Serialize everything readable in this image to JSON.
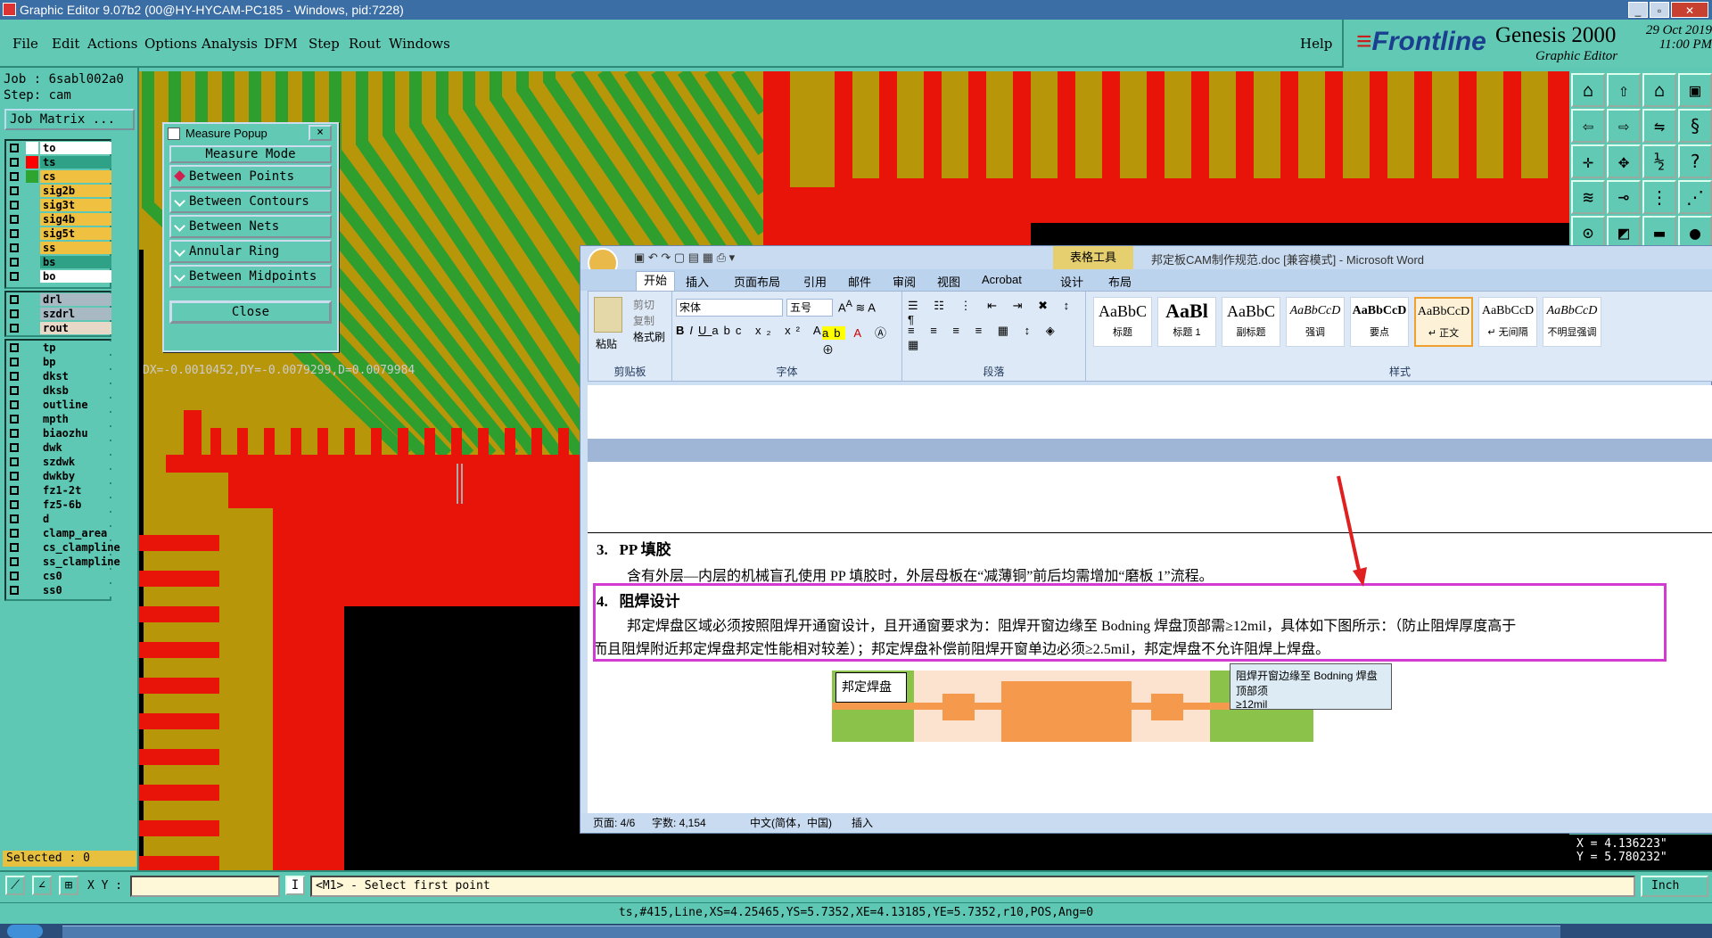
{
  "window": {
    "title": "Graphic Editor 9.07b2 (00@HY-HYCAM-PC185 - Windows, pid:7228)"
  },
  "menu": [
    "File",
    "Edit",
    "Actions",
    "Options",
    "Analysis",
    "DFM",
    "Step",
    "Rout",
    "Windows"
  ],
  "help_label": "Help",
  "brand": {
    "logo_main": "Frontline",
    "product": "Genesis 2000",
    "subtitle": "Graphic Editor",
    "date": "29 Oct 2019",
    "time": "11:00 PM"
  },
  "job": {
    "job_line": "Job : 6sabl002a0",
    "step_line": "Step: cam",
    "matrix_button": "Job Matrix ..."
  },
  "layers_group1": [
    {
      "name": "to",
      "color": "#ffffff",
      "namebg": "#ffffff"
    },
    {
      "name": "ts",
      "color": "#ff0000",
      "namebg": "#2fa187"
    },
    {
      "name": "cs",
      "color": "#2ea52e",
      "namebg": "#f0c040"
    },
    {
      "name": "sig2b",
      "color": "",
      "namebg": "#f0c040"
    },
    {
      "name": "sig3t",
      "color": "",
      "namebg": "#f0c040"
    },
    {
      "name": "sig4b",
      "color": "",
      "namebg": "#f0c040"
    },
    {
      "name": "sig5t",
      "color": "",
      "namebg": "#f0c040"
    },
    {
      "name": "ss",
      "color": "",
      "namebg": "#f0c040"
    },
    {
      "name": "bs",
      "color": "",
      "namebg": "#2fa187"
    },
    {
      "name": "bo",
      "color": "",
      "namebg": "#ffffff"
    }
  ],
  "layers_group2": [
    {
      "name": "drl",
      "namebg": "#a9b9c4"
    },
    {
      "name": "szdrl",
      "namebg": "#a9b9c4"
    },
    {
      "name": "rout",
      "namebg": "#e8d8c8"
    }
  ],
  "layers_group3": [
    {
      "name": "tp",
      "namebg": "#5ec8b4"
    },
    {
      "name": "bp",
      "namebg": "#5ec8b4"
    },
    {
      "name": "dkst",
      "namebg": "#5ec8b4"
    },
    {
      "name": "dksb",
      "namebg": "#5ec8b4"
    },
    {
      "name": "outline",
      "namebg": "#5ec8b4"
    },
    {
      "name": "mpth",
      "namebg": "#5ec8b4"
    },
    {
      "name": "biaozhu",
      "namebg": "#5ec8b4"
    },
    {
      "name": "dwk",
      "namebg": "#5ec8b4"
    },
    {
      "name": "szdwk",
      "namebg": "#5ec8b4"
    },
    {
      "name": "dwkby",
      "namebg": "#5ec8b4"
    },
    {
      "name": "fz1-2t",
      "namebg": "#5ec8b4"
    },
    {
      "name": "fz5-6b",
      "namebg": "#5ec8b4"
    },
    {
      "name": "d",
      "namebg": "#5ec8b4"
    },
    {
      "name": "clamp_area",
      "namebg": "#5ec8b4"
    },
    {
      "name": "cs_clampline",
      "namebg": "#5ec8b4"
    },
    {
      "name": "ss_clampline",
      "namebg": "#5ec8b4"
    },
    {
      "name": "cs0",
      "namebg": "#5ec8b4"
    },
    {
      "name": "ss0",
      "namebg": "#5ec8b4"
    }
  ],
  "selected_text": "Selected : 0",
  "measure_popup": {
    "title": "Measure Popup",
    "close_x": "×",
    "mode_label": "Measure Mode",
    "options": [
      "Between Points",
      "Between Contours",
      "Between Nets",
      "Annular Ring",
      "Between Midpoints"
    ],
    "selected_index": 0,
    "close_label": "Close"
  },
  "measure_readout": "DX=-0.0010452,DY=-0.0079299,D=0.0079984",
  "coord_readout": {
    "x": "X = 4.136223\"",
    "y": "Y = 5.780232\""
  },
  "word": {
    "title": "邦定板CAM制作规范.doc [兼容模式] - Microsoft Word",
    "context_tab": "表格工具",
    "tabs": [
      "开始",
      "插入",
      "页面布局",
      "引用",
      "邮件",
      "审阅",
      "视图",
      "Acrobat",
      "设计",
      "布局"
    ],
    "clipboard": {
      "paste": "粘贴",
      "cut": "剪切",
      "copy": "复制",
      "format_painter": "格式刷",
      "label": "剪贴板"
    },
    "font": {
      "name": "宋体",
      "size": "五号",
      "label": "字体"
    },
    "paragraph_label": "段落",
    "styles_label": "样式",
    "styles": [
      {
        "preview": "AaBbC",
        "label": "标题"
      },
      {
        "preview": "AaBl",
        "label": "标题 1"
      },
      {
        "preview": "AaBbC",
        "label": "副标题"
      },
      {
        "preview": "AaBbCcD",
        "label": "强调"
      },
      {
        "preview": "AaBbCcD",
        "label": "要点"
      },
      {
        "preview": "AaBbCcD",
        "label": "↵ 正文"
      },
      {
        "preview": "AaBbCcD",
        "label": "↵ 无间隔"
      },
      {
        "preview": "AaBbCcD",
        "label": "不明显强调"
      }
    ],
    "doc": {
      "h3_num": "3.",
      "h3_title": "PP 填胶",
      "p3": "含有外层—内层的机械盲孔使用 PP 填胶时，外层母板在“减薄铜”前后均需增加“磨板 1”流程。",
      "h4_num": "4.",
      "h4_title": "阻焊设计",
      "p4a": "邦定焊盘区域必须按照阻焊开通窗设计，且开通窗要求为：阻焊开窗边缘至 Bodning 焊盘顶部需≥12mil，具体如下图所示：（防止阻焊厚度高于",
      "p4b": "而且阻焊附近邦定焊盘邦定性能相对较差）；邦定焊盘补偿前阻焊开窗单边必须≥2.5mil，邦定焊盘不允许阻焊上焊盘。",
      "fig_label_left": "邦定焊盘",
      "fig_label_right1": "阻焊开窗边缘至 Bodning 焊盘顶部须",
      "fig_label_right2": "≥12mil"
    },
    "status": {
      "page": "页面: 4/6",
      "words": "字数: 4,154",
      "lang": "中文(简体，中国)",
      "mode": "插入"
    }
  },
  "command": {
    "xy_label": "X Y :",
    "prompt": "<M1> - Select first point",
    "units": "Inch"
  },
  "status_line": "ts,#415,Line,XS=4.25465,YS=5.7352,XE=4.13185,YE=5.7352,r10,POS,Ang=0"
}
